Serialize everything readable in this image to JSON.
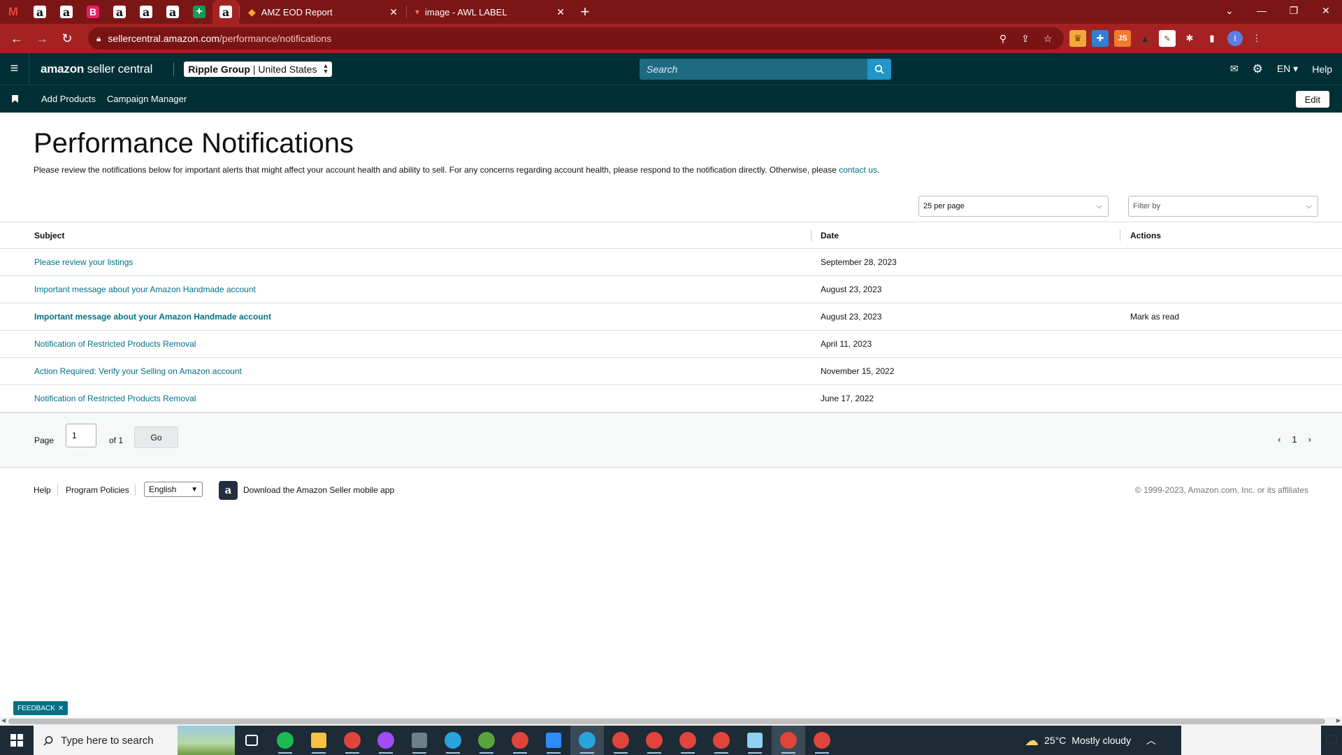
{
  "browser": {
    "pinned_tabs": [
      {
        "icon": "gmail-icon",
        "glyph": "M",
        "style": "gmail"
      },
      {
        "icon": "amazon-icon",
        "glyph": "a",
        "style": "amz"
      },
      {
        "icon": "amazon-icon",
        "glyph": "a",
        "style": "amz"
      },
      {
        "icon": "bonanza-icon",
        "glyph": "B",
        "style": "b"
      },
      {
        "icon": "amazon-icon",
        "glyph": "a",
        "style": "amz"
      },
      {
        "icon": "amazon-icon",
        "glyph": "a",
        "style": "amz"
      },
      {
        "icon": "amazon-icon",
        "glyph": "a",
        "style": "amz"
      },
      {
        "icon": "sheets-icon",
        "glyph": "+",
        "style": "sheets"
      },
      {
        "icon": "amazon-icon",
        "glyph": "a",
        "style": "amz",
        "active": true
      }
    ],
    "tabs": [
      {
        "title": "AMZ EOD Report"
      },
      {
        "title": "image - AWL LABEL"
      }
    ],
    "url_host": "sellercentral.amazon.com",
    "url_path": "/performance/notifications"
  },
  "header": {
    "logo_brand": "amazon",
    "logo_product": "seller central",
    "account_name": "Ripple Group",
    "account_region": "| United States",
    "search_placeholder": "Search",
    "language": "EN",
    "help": "Help"
  },
  "bookmarks": {
    "items": [
      "Add Products",
      "Campaign Manager"
    ],
    "edit": "Edit"
  },
  "page": {
    "title": "Performance Notifications",
    "intro": "Please review the notifications below for important alerts that might affect your account health and ability to sell. For any concerns regarding account health, please respond to the notification directly. Otherwise, please ",
    "contact_link": "contact us",
    "intro_end": "."
  },
  "controls": {
    "per_page": "25 per page",
    "filter": "Filter by"
  },
  "table": {
    "columns": {
      "subject": "Subject",
      "date": "Date",
      "actions": "Actions"
    },
    "rows": [
      {
        "subject": "Please review your listings",
        "date": "September 28, 2023",
        "action": "",
        "unread": false
      },
      {
        "subject": "Important message about your Amazon Handmade account",
        "date": "August 23, 2023",
        "action": "",
        "unread": false
      },
      {
        "subject": "Important message about your Amazon Handmade account",
        "date": "August 23, 2023",
        "action": "Mark as read",
        "unread": true
      },
      {
        "subject": "Notification of Restricted Products Removal",
        "date": "April 11, 2023",
        "action": "",
        "unread": false
      },
      {
        "subject": "Action Required: Verify your Selling on Amazon account",
        "date": "November 15, 2022",
        "action": "",
        "unread": false
      },
      {
        "subject": "Notification of Restricted Products Removal",
        "date": "June 17, 2022",
        "action": "",
        "unread": false
      }
    ]
  },
  "pager": {
    "label": "Page",
    "value": "1",
    "of": "of 1",
    "go": "Go",
    "current": "1"
  },
  "footer": {
    "help": "Help",
    "policies": "Program Policies",
    "language": "English",
    "app": "Download the Amazon Seller mobile app",
    "copyright": "© 1999-2023, Amazon.com, Inc. or its affiliates"
  },
  "feedback": "FEEDBACK",
  "taskbar": {
    "search_placeholder": "Type here to search",
    "weather_temp": "25°C",
    "weather_desc": "Mostly cloudy",
    "apps": [
      {
        "name": "task-view-icon",
        "color": "#ffffff",
        "shape": "sq"
      },
      {
        "name": "spotify-icon",
        "color": "#1db954",
        "shape": "dot"
      },
      {
        "name": "file-explorer-icon",
        "color": "#f5c242",
        "shape": "sq"
      },
      {
        "name": "chrome-icon",
        "color": "#e0443a",
        "shape": "dot"
      },
      {
        "name": "messenger-icon",
        "color": "#a24cf5",
        "shape": "dot"
      },
      {
        "name": "calculator-icon",
        "color": "#6e7f8c",
        "shape": "sq"
      },
      {
        "name": "telegram-icon",
        "color": "#2aa3df",
        "shape": "dot"
      },
      {
        "name": "utorrent-icon",
        "color": "#5aa43a",
        "shape": "dot"
      },
      {
        "name": "chrome-profile-icon",
        "color": "#e0443a",
        "shape": "dot"
      },
      {
        "name": "zoom-icon",
        "color": "#2d8cff",
        "shape": "sq"
      },
      {
        "name": "telegram-desktop-icon",
        "color": "#2aa3df",
        "shape": "dot"
      },
      {
        "name": "chrome-profile-icon",
        "color": "#e0443a",
        "shape": "dot"
      },
      {
        "name": "chrome-profile-icon",
        "color": "#e0443a",
        "shape": "dot"
      },
      {
        "name": "chrome-profile-icon",
        "color": "#e0443a",
        "shape": "dot"
      },
      {
        "name": "chrome-profile-icon",
        "color": "#e0443a",
        "shape": "dot"
      },
      {
        "name": "notepad-icon",
        "color": "#8fd0f5",
        "shape": "sq"
      },
      {
        "name": "chrome-profile-icon",
        "color": "#e0443a",
        "shape": "dot"
      },
      {
        "name": "chrome-profile-icon",
        "color": "#e0443a",
        "shape": "dot"
      }
    ]
  }
}
